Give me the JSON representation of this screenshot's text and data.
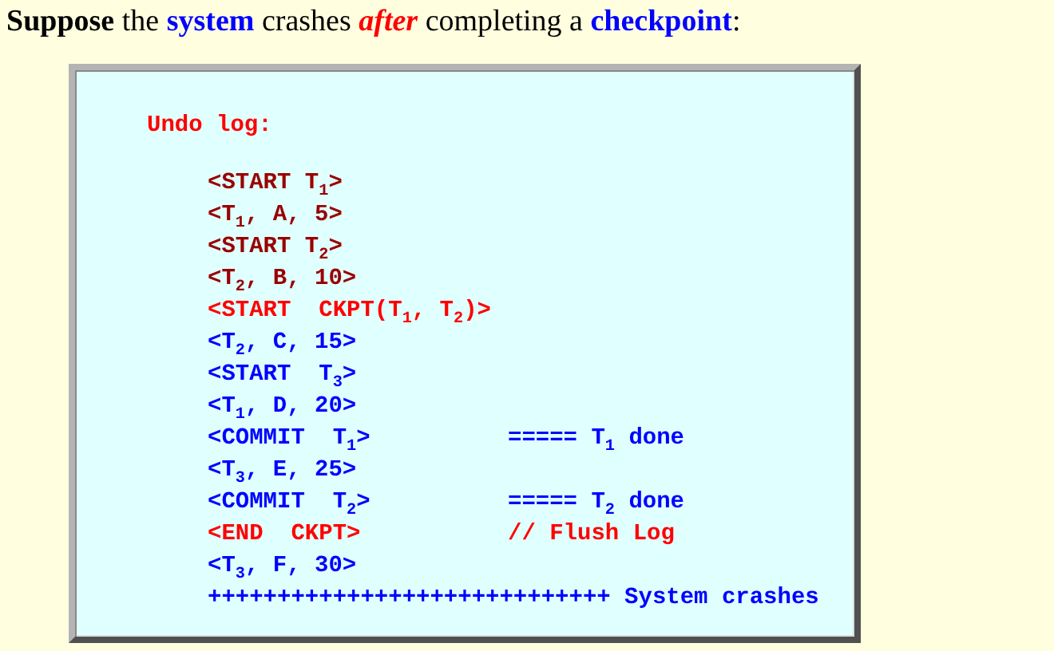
{
  "heading": [
    {
      "text": "Suppose",
      "kind": "strong"
    },
    {
      "text": " the ",
      "kind": "plain"
    },
    {
      "text": "system",
      "kind": "term"
    },
    {
      "text": " crashes ",
      "kind": "plain"
    },
    {
      "text": "after",
      "kind": "stress"
    },
    {
      "text": " completing a ",
      "kind": "plain"
    },
    {
      "text": "checkpoint",
      "kind": "term"
    },
    {
      "text": ":",
      "kind": "plain"
    }
  ],
  "log_title": "Undo log:",
  "log": [
    {
      "text": "<START T$_{1}$>",
      "color": "#990000"
    },
    {
      "text": "<T$_{1}$, A, 5>",
      "color": "#990000"
    },
    {
      "text": "<START T$_{2}$>",
      "color": "#990000"
    },
    {
      "text": "<T$_{2}$, B, 10>",
      "color": "#990000"
    },
    {
      "text": "<START  CKPT(T$_{1}$, T$_{2}$)>",
      "color": "#ff0000"
    },
    {
      "text": "<T$_{2}$, C, 15>",
      "color": "#0000ff"
    },
    {
      "text": "<START  T$_{3}$>",
      "color": "#0000ff"
    },
    {
      "text": "<T$_{1}$, D, 20>",
      "color": "#0000ff"
    },
    {
      "text": "<COMMIT  T$_{1}$>",
      "color": "#0000ff",
      "note": "===== T$_{1}$ done"
    },
    {
      "text": "<T$_{3}$, E, 25>",
      "color": "#0000ff"
    },
    {
      "text": "<COMMIT  T$_{2}$>",
      "color": "#0000ff",
      "note": "===== T$_{2}$ done"
    },
    {
      "text": "<END  CKPT>",
      "color": "#ff0000",
      "note": "// Flush Log"
    },
    {
      "text": "<T$_{3}$, F, 30>",
      "color": "#0000ff"
    },
    {
      "text": "+++++++++++++++++++++++++++++ System crashes",
      "color": "#0000ff"
    }
  ]
}
